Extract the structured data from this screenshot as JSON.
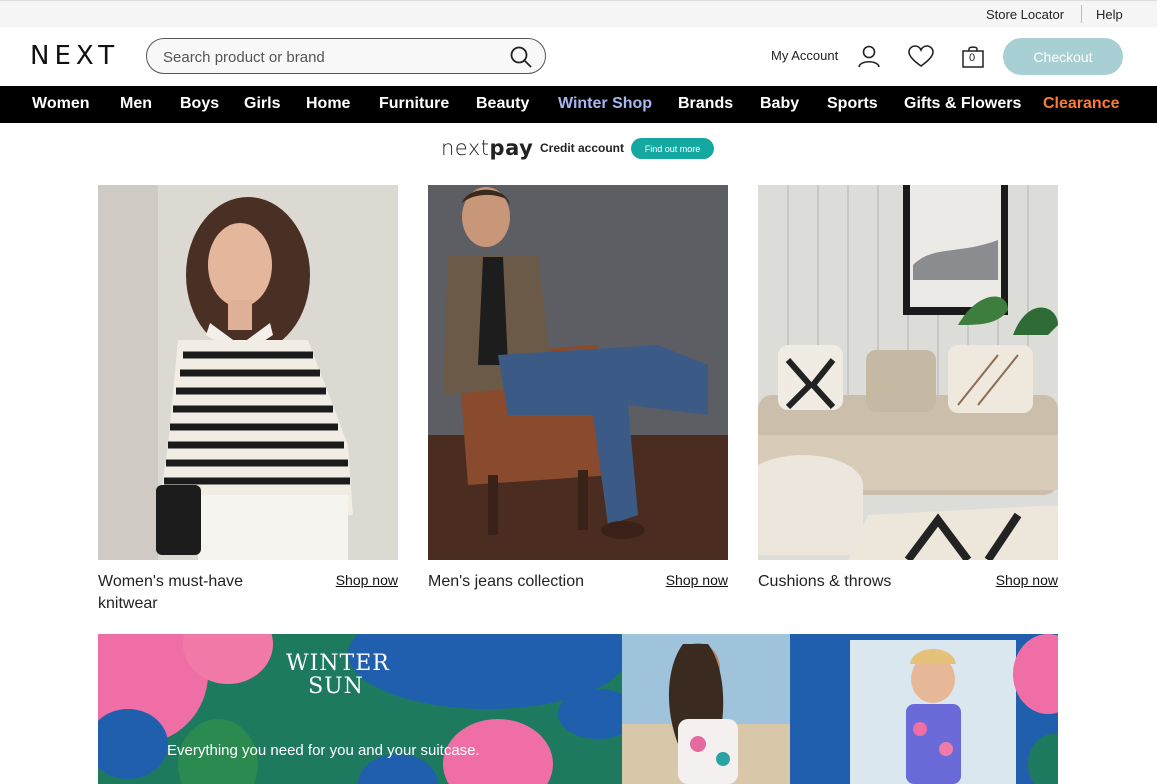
{
  "utility": {
    "store_locator": "Store Locator",
    "help": "Help"
  },
  "header": {
    "logo": "NEXT",
    "search_placeholder": "Search product or brand",
    "account_label": "My Account",
    "bag_count": "0",
    "checkout_label": "Checkout"
  },
  "nav": {
    "items": [
      "Women",
      "Men",
      "Boys",
      "Girls",
      "Home",
      "Furniture",
      "Beauty",
      "Winter Shop",
      "Brands",
      "Baby",
      "Sports",
      "Gifts & Flowers",
      "Clearance"
    ],
    "highlight_colors": {
      "winter_shop": "#a7b6f0",
      "clearance": "#ff7b2e"
    }
  },
  "nextpay": {
    "brand_light": "next",
    "brand_bold": "pay",
    "credit_label": "Credit account",
    "cta": "Find out more"
  },
  "cards": [
    {
      "title": "Women's must-have knitwear",
      "cta": "Shop now"
    },
    {
      "title": "Men's jeans collection",
      "cta": "Shop now"
    },
    {
      "title": "Cushions & throws",
      "cta": "Shop now"
    }
  ],
  "winter_banner": {
    "title_line1": "WINTER",
    "title_line2": "SUN",
    "subtitle": "Everything you need for you and your suitcase."
  },
  "colors": {
    "checkout_bg": "#a8cfd3",
    "nav_bg": "#000000",
    "nextpay_cta": "#14a8a0",
    "banner_green": "#1e7a5f",
    "banner_blue": "#1f5fae",
    "banner_pink": "#f06ea6"
  }
}
